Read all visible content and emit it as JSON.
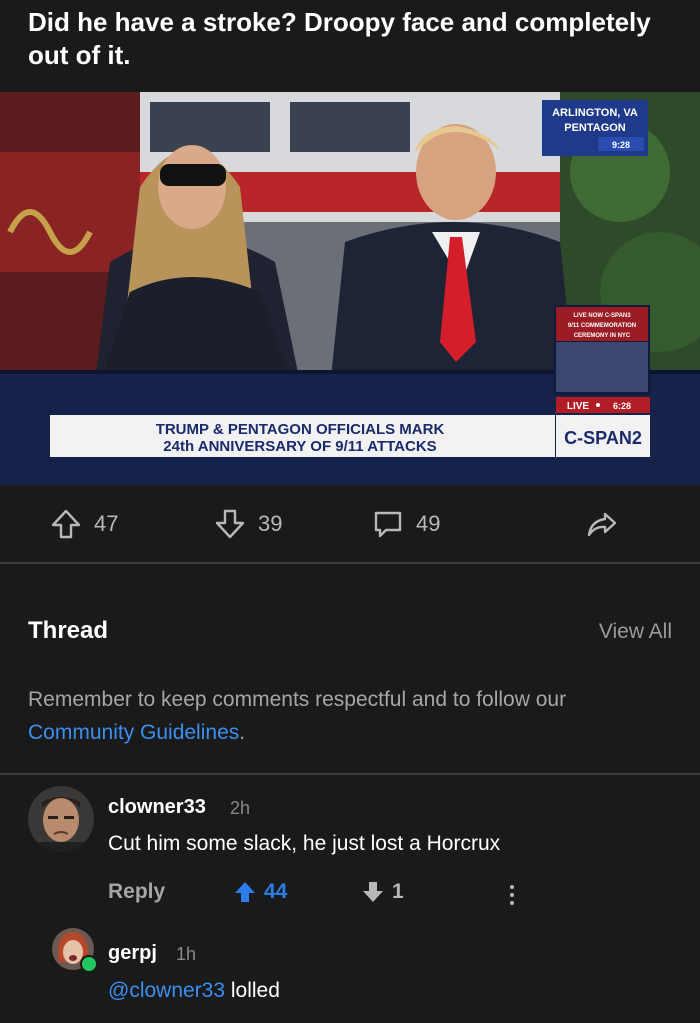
{
  "post": {
    "title": "Did he have a stroke? Droopy face and completely out of it."
  },
  "media": {
    "location_line1": "ARLINGTON, VA",
    "location_line2": "PENTAGON",
    "clock": "9:28",
    "inset_line1": "LIVE NOW C-SPAN3",
    "inset_line2": "9/11 COMMEMORATION",
    "inset_line3": "CEREMONY IN NYC",
    "live_label": "LIVE",
    "live_time": "6:28",
    "chyron_line1": "TRUMP & PENTAGON OFFICIALS MARK",
    "chyron_line2": "24th ANNIVERSARY OF 9/11 ATTACKS",
    "network": "C-SPAN2"
  },
  "actions": {
    "upvotes": "47",
    "downvotes": "39",
    "comments": "49"
  },
  "thread": {
    "heading": "Thread",
    "view_all": "View All",
    "notice_text": "Remember to keep comments respectful and to follow our ",
    "notice_link": "Community Guidelines",
    "notice_end": "."
  },
  "comments": [
    {
      "username": "clowner33",
      "time": "2h",
      "body": "Cut him some slack, he just lost a Horcrux",
      "reply_label": "Reply",
      "upvotes": "44",
      "downvotes": "1"
    },
    {
      "username": "gerpj",
      "time": "1h",
      "mention": "@clowner33",
      "body": " lolled"
    }
  ],
  "colors": {
    "background": "#1a1a1a",
    "link": "#3b8ff0",
    "upvote_active": "#2b7de9",
    "online": "#22c55e"
  }
}
